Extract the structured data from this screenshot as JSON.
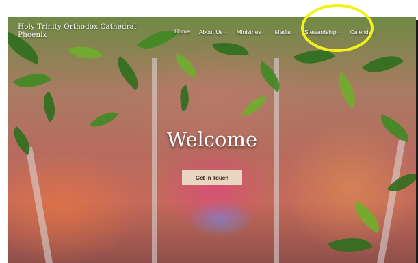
{
  "site": {
    "title": "Holy Trinity Orthodox Cathedral Phoenix"
  },
  "nav": {
    "items": [
      {
        "label": "Home",
        "active": true,
        "has_dropdown": false
      },
      {
        "label": "About Us",
        "active": false,
        "has_dropdown": true
      },
      {
        "label": "Ministries",
        "active": false,
        "has_dropdown": true
      },
      {
        "label": "Media",
        "active": false,
        "has_dropdown": true
      },
      {
        "label": "Stewardship",
        "active": false,
        "has_dropdown": true
      },
      {
        "label": "Calendar",
        "active": false,
        "has_dropdown": false
      }
    ]
  },
  "hero": {
    "title": "Welcome",
    "button_label": "Get in Touch"
  },
  "icons": {
    "dropdown": "chevron-down-icon"
  },
  "colors": {
    "highlight": "#f2f21a",
    "button_bg": "#e9d6c1"
  }
}
